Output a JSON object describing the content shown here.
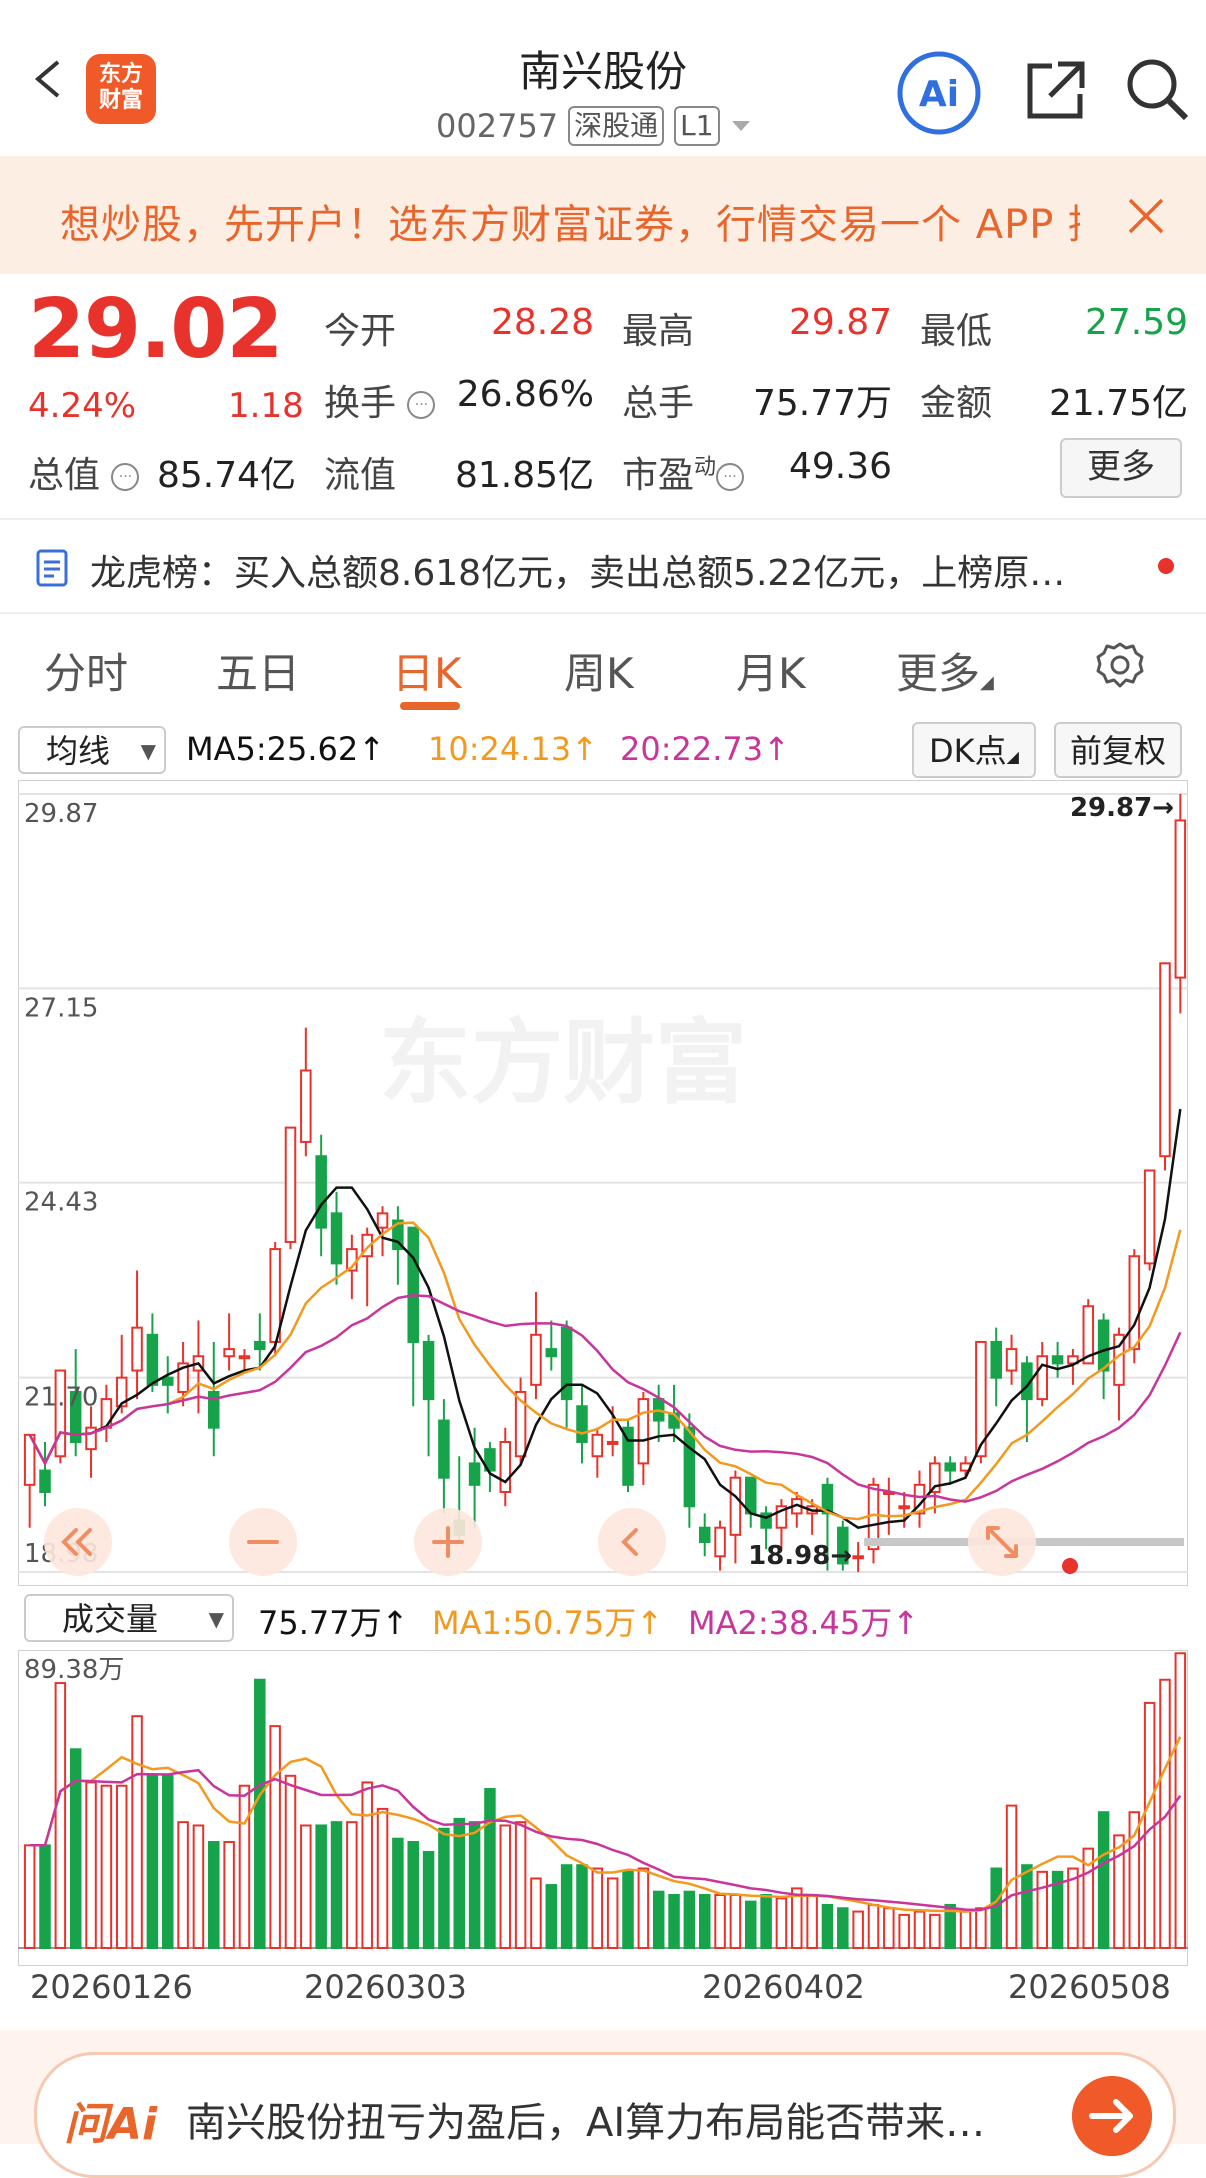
{
  "header": {
    "title": "南兴股份",
    "code": "002757",
    "tag_market": "深股通",
    "tag_level": "L1",
    "logo_text_1": "东方",
    "logo_text_2": "财富",
    "ai_label": "Ai"
  },
  "promo": {
    "text": "想炒股，先开户！选东方财富证券，行情交易一个 APP 搞定"
  },
  "quote": {
    "price": "29.02",
    "change_pct": "4.24%",
    "change_val": "1.18",
    "fields": {
      "open_label": "今开",
      "open": "28.28",
      "high_label": "最高",
      "high": "29.87",
      "low_label": "最低",
      "low": "27.59",
      "turnover_label": "换手",
      "turnover": "26.86%",
      "volume_label": "总手",
      "volume": "75.77万",
      "amount_label": "金额",
      "amount": "21.75亿",
      "mktcap_label": "总值",
      "mktcap": "85.74亿",
      "float_label": "流值",
      "float": "81.85亿",
      "pe_label": "市盈",
      "pe_sup": "动",
      "pe": "49.36"
    },
    "more_label": "更多"
  },
  "dragon": {
    "text": "龙虎榜：买入总额8.618亿元，卖出总额5.22亿元，上榜原…"
  },
  "tabs": [
    "分时",
    "五日",
    "日K",
    "周K",
    "月K",
    "更多"
  ],
  "active_tab": "日K",
  "ma_bar": {
    "select": "均线",
    "ma5": "MA5:25.62↑",
    "ma10": "10:24.13↑",
    "ma20": "20:22.73↑",
    "dk_label": "DK点",
    "fq_label": "前复权"
  },
  "vol_bar": {
    "select": "成交量",
    "vol": "75.77万↑",
    "ma1": "MA1:50.75万↑",
    "ma2": "MA2:38.45万↑"
  },
  "bottom_bar": {
    "logo": "问Ai",
    "text": "南兴股份扭亏为盈后，AI算力布局能否带来…"
  },
  "colors": {
    "up": "#e8322c",
    "down": "#16a34a",
    "ma5": "#111111",
    "ma10": "#f29a1f",
    "ma20": "#c8359b",
    "accent": "#e8662c"
  },
  "chart_data": [
    {
      "type": "candlestick",
      "ylim": [
        18.98,
        29.87
      ],
      "y_ticks": [
        "29.87",
        "27.15",
        "24.43",
        "21.70",
        "18.98"
      ],
      "x_labels": [
        "20260126",
        "20260303",
        "20260402",
        "20260508"
      ],
      "watermark": "东方财富",
      "annotations": {
        "high_label": "29.87→",
        "low_label": "18.98→"
      },
      "candles": [
        [
          20.2,
          20.9,
          19.6,
          20.8
        ],
        [
          20.4,
          20.1,
          19.9,
          20.8
        ],
        [
          20.6,
          21.8,
          20.5,
          21.7
        ],
        [
          21.5,
          20.8,
          20.6,
          22.1
        ],
        [
          20.7,
          21.0,
          20.3,
          21.3
        ],
        [
          21.0,
          21.4,
          20.8,
          21.6
        ],
        [
          21.3,
          21.7,
          21.2,
          22.3
        ],
        [
          21.8,
          22.4,
          21.4,
          23.2
        ],
        [
          22.3,
          21.6,
          21.5,
          22.6
        ],
        [
          21.7,
          21.6,
          21.2,
          22.0
        ],
        [
          21.5,
          21.9,
          21.3,
          22.2
        ],
        [
          21.8,
          22.0,
          21.2,
          22.5
        ],
        [
          21.5,
          21.0,
          20.6,
          22.2
        ],
        [
          22.0,
          22.1,
          21.8,
          22.6
        ],
        [
          22.0,
          22.0,
          21.8,
          22.1
        ],
        [
          22.2,
          22.1,
          21.8,
          22.6
        ],
        [
          22.2,
          23.5,
          22.0,
          23.6
        ],
        [
          23.6,
          25.2,
          23.5,
          25.2
        ],
        [
          25.0,
          26.0,
          24.8,
          26.6
        ],
        [
          24.8,
          23.8,
          23.4,
          25.1
        ],
        [
          24.0,
          23.3,
          23.0,
          24.3
        ],
        [
          23.2,
          23.5,
          22.8,
          23.7
        ],
        [
          23.4,
          23.7,
          22.7,
          23.8
        ],
        [
          23.8,
          24.0,
          23.4,
          24.1
        ],
        [
          23.9,
          23.5,
          23.0,
          24.1
        ],
        [
          23.8,
          22.2,
          21.3,
          22.4
        ],
        [
          22.2,
          21.4,
          20.6,
          22.3
        ],
        [
          21.1,
          20.3,
          19.8,
          21.4
        ],
        [
          19.7,
          19.5,
          19.4,
          20.6
        ],
        [
          20.5,
          20.2,
          19.6,
          21.0
        ],
        [
          20.7,
          20.4,
          20.1,
          20.8
        ],
        [
          20.1,
          20.8,
          19.9,
          21.0
        ],
        [
          20.6,
          21.5,
          20.5,
          21.7
        ],
        [
          21.6,
          22.3,
          21.4,
          22.9
        ],
        [
          22.1,
          22.0,
          21.8,
          22.5
        ],
        [
          22.4,
          21.4,
          21.0,
          22.5
        ],
        [
          21.3,
          20.8,
          20.5,
          21.6
        ],
        [
          20.6,
          20.9,
          20.3,
          21.0
        ],
        [
          20.8,
          20.8,
          20.6,
          21.3
        ],
        [
          21.0,
          20.2,
          20.1,
          21.1
        ],
        [
          20.5,
          21.4,
          20.2,
          21.5
        ],
        [
          21.4,
          21.1,
          20.8,
          21.6
        ],
        [
          21.2,
          21.0,
          20.8,
          21.6
        ],
        [
          21.0,
          19.9,
          19.6,
          21.2
        ],
        [
          19.6,
          19.4,
          19.2,
          19.8
        ],
        [
          19.2,
          19.6,
          19.0,
          19.7
        ],
        [
          19.5,
          20.3,
          19.1,
          20.4
        ],
        [
          20.3,
          19.8,
          19.6,
          20.3
        ],
        [
          19.8,
          19.6,
          19.3,
          19.9
        ],
        [
          19.6,
          19.9,
          19.3,
          20.0
        ],
        [
          19.8,
          20.0,
          19.6,
          20.1
        ],
        [
          19.8,
          19.9,
          19.5,
          20.0
        ],
        [
          20.2,
          19.8,
          19.0,
          20.3
        ],
        [
          19.6,
          19.1,
          19.0,
          19.7
        ],
        [
          19.2,
          19.2,
          18.98,
          19.4
        ],
        [
          19.3,
          20.2,
          19.1,
          20.3
        ],
        [
          20.1,
          20.1,
          19.5,
          20.3
        ],
        [
          19.9,
          19.9,
          19.6,
          20.1
        ],
        [
          19.8,
          20.2,
          19.6,
          20.4
        ],
        [
          20.1,
          20.5,
          19.8,
          20.6
        ],
        [
          20.5,
          20.4,
          20.2,
          20.6
        ],
        [
          20.4,
          20.5,
          20.3,
          20.6
        ],
        [
          20.6,
          22.2,
          20.5,
          22.2
        ],
        [
          22.2,
          21.7,
          21.3,
          22.4
        ],
        [
          21.8,
          22.1,
          21.6,
          22.3
        ],
        [
          21.9,
          21.4,
          20.8,
          22.0
        ],
        [
          21.4,
          22.0,
          21.3,
          22.2
        ],
        [
          22.0,
          21.9,
          21.7,
          22.2
        ],
        [
          21.9,
          22.0,
          21.6,
          22.1
        ],
        [
          21.9,
          22.7,
          21.9,
          22.8
        ],
        [
          22.5,
          21.8,
          21.4,
          22.6
        ],
        [
          21.6,
          22.3,
          21.1,
          22.4
        ],
        [
          22.1,
          23.4,
          21.9,
          23.5
        ],
        [
          23.3,
          24.6,
          23.2,
          24.6
        ],
        [
          24.8,
          27.5,
          24.6,
          27.5
        ],
        [
          27.3,
          29.5,
          26.8,
          29.87
        ]
      ]
    },
    {
      "type": "bar",
      "title": "成交量",
      "ymax_label": "89.38万",
      "ylim": [
        0,
        89.38
      ],
      "values": [
        31,
        31,
        80,
        60,
        50,
        49,
        49,
        70,
        52,
        52,
        38,
        37,
        32,
        32,
        49,
        81,
        67,
        52,
        37,
        37,
        38,
        38,
        50,
        42,
        33,
        32,
        29,
        36,
        39,
        38,
        48,
        37,
        38,
        21,
        19,
        25,
        25,
        24,
        21,
        23,
        24,
        17,
        16,
        17,
        16,
        16,
        16,
        14,
        16,
        15,
        18,
        16,
        13,
        12,
        11,
        13,
        12,
        10,
        11,
        10,
        13,
        11,
        12,
        24,
        43,
        25,
        23,
        23,
        24,
        30,
        41,
        34,
        41,
        74,
        81,
        89
      ]
    }
  ]
}
